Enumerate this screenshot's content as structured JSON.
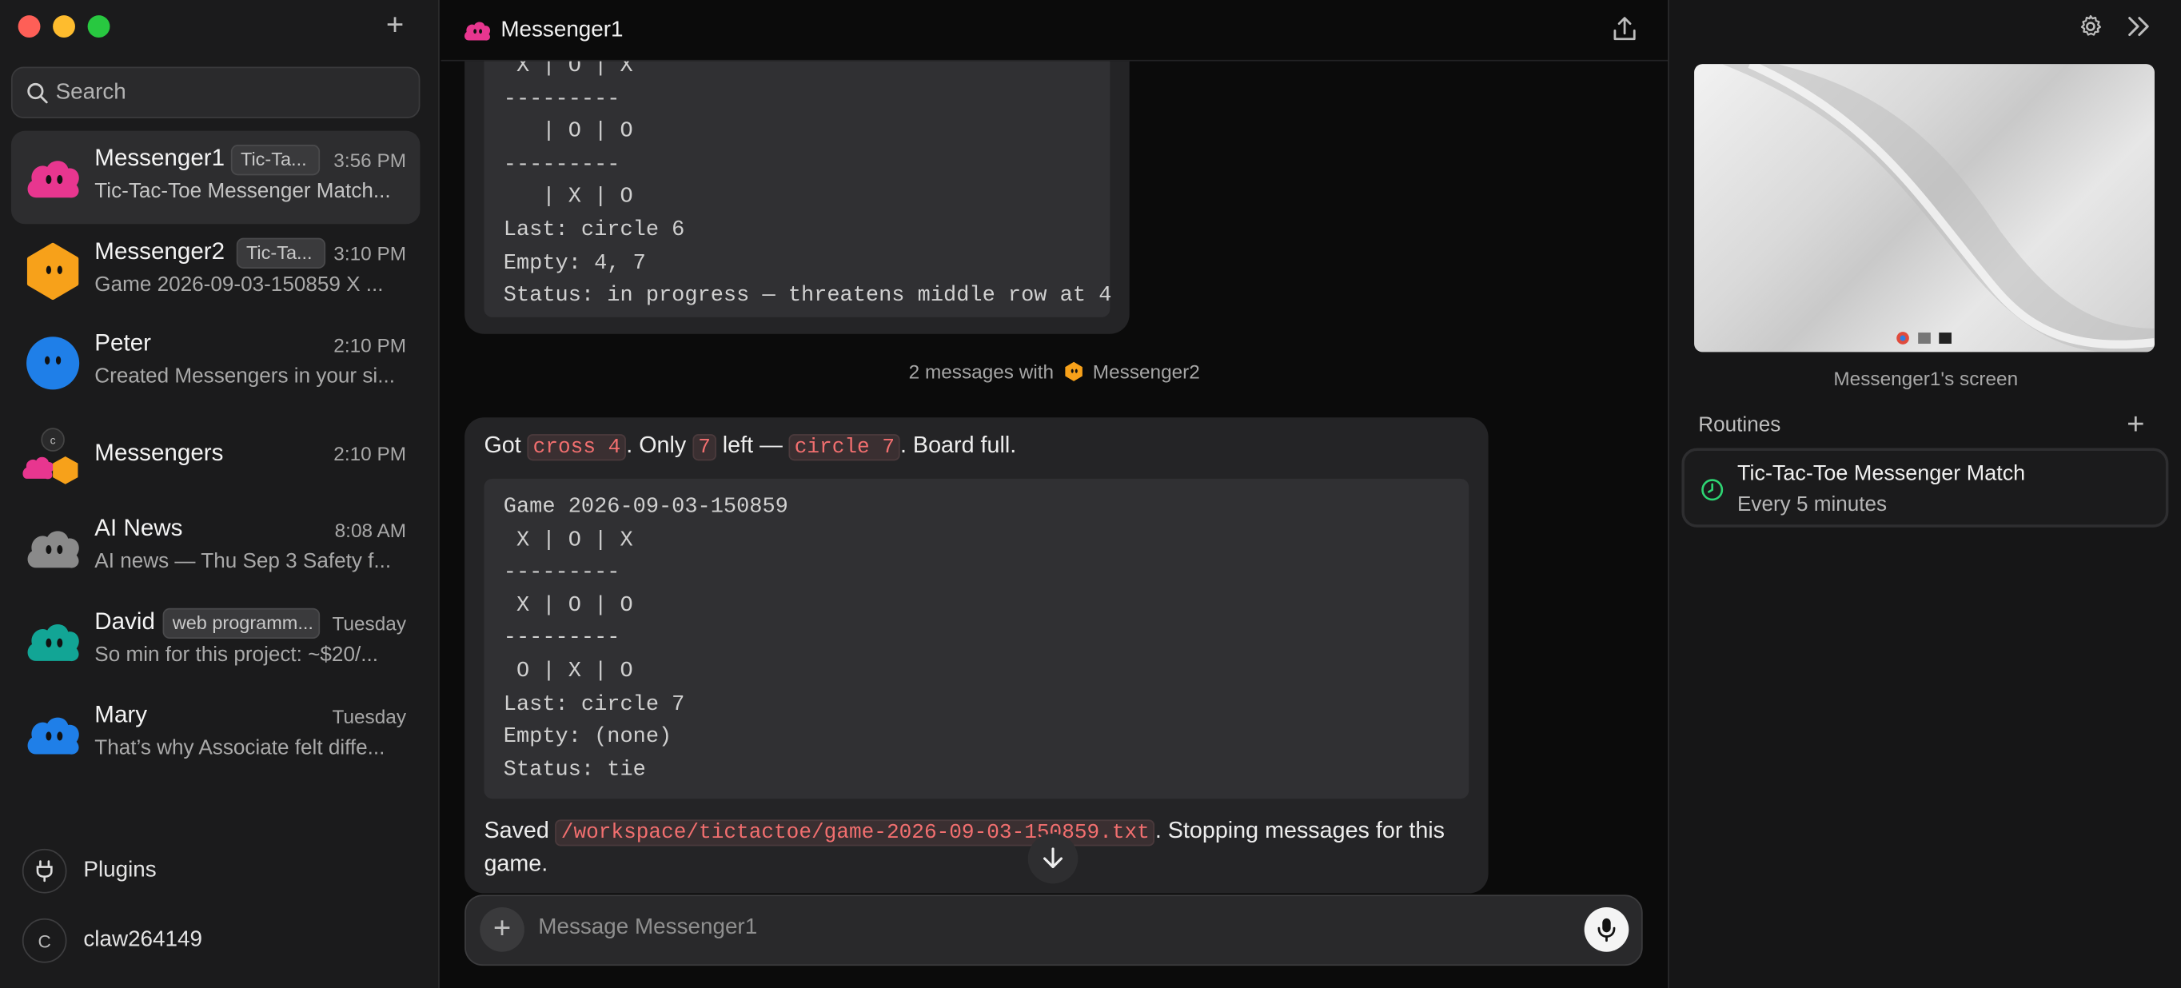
{
  "sidebar": {
    "search_placeholder": "Search",
    "chats": [
      {
        "name": "Messenger1",
        "tag": "Tic-Ta...",
        "time": "3:56 PM",
        "preview": "Tic-Tac-Toe Messenger Match...",
        "avatar_color": "#e8368f",
        "avatar": "pink-cloud"
      },
      {
        "name": "Messenger2",
        "tag": "Tic-Ta...",
        "time": "3:10 PM",
        "preview": "Game 2026-09-03-150859 X ...",
        "avatar_color": "#f7a11a",
        "avatar": "orange-hexagon"
      },
      {
        "name": "Peter",
        "time": "2:10 PM",
        "preview": "Created Messengers in your si...",
        "avatar_color": "#1f7fe8",
        "avatar": "blue-circle"
      },
      {
        "name": "Messengers",
        "time": "2:10 PM",
        "avatar": "group",
        "avatar_letter": "c"
      },
      {
        "name": "AI News",
        "time": "8:08 AM",
        "preview": "AI news — Thu Sep 3 Safety f...",
        "avatar_color": "#8a8a8a",
        "avatar": "gray-cloud"
      },
      {
        "name": "David",
        "tag": "web programm...",
        "time": "Tuesday",
        "preview": "So min for this project: ~$20/...",
        "avatar_color": "#12a595",
        "avatar": "teal-cloud"
      },
      {
        "name": "Mary",
        "time": "Tuesday",
        "preview": "That’s why Associate felt diffe...",
        "avatar_color": "#1f7fe8",
        "avatar": "blue-cloud"
      }
    ],
    "plugins_label": "Plugins",
    "user_initial": "C",
    "user_name": "claw264149"
  },
  "main": {
    "title": "Messenger1",
    "msg1_code": " X | O | X\n---------\n   | O | O\n---------\n   | X | O\nLast: circle 6\nEmpty: 4, 7\nStatus: in progress — threatens middle row at 4",
    "divider_prefix": "2 messages with",
    "divider_name": "Messenger2",
    "msg2": {
      "t1": "Got ",
      "c1": "cross 4",
      "t2": ". Only ",
      "c2": "7",
      "t3": " left — ",
      "c3": "circle 7",
      "t4": ". Board full.",
      "code": "Game 2026-09-03-150859\n X | O | X\n---------\n X | O | O\n---------\n O | X | O\nLast: circle 7\nEmpty: (none)\nStatus: tie",
      "saved": "Saved ",
      "path": "/workspace/tictactoe/game-2026-09-03-150859.txt",
      "saved_end": ". Stopping messages for this game."
    },
    "composer_placeholder": "Message Messenger1"
  },
  "right": {
    "screen_caption": "Messenger1's screen",
    "routines_title": "Routines",
    "routine_title": "Tic-Tac-Toe Messenger Match",
    "routine_sub": "Every 5 minutes",
    "accent": "#2ed573"
  }
}
